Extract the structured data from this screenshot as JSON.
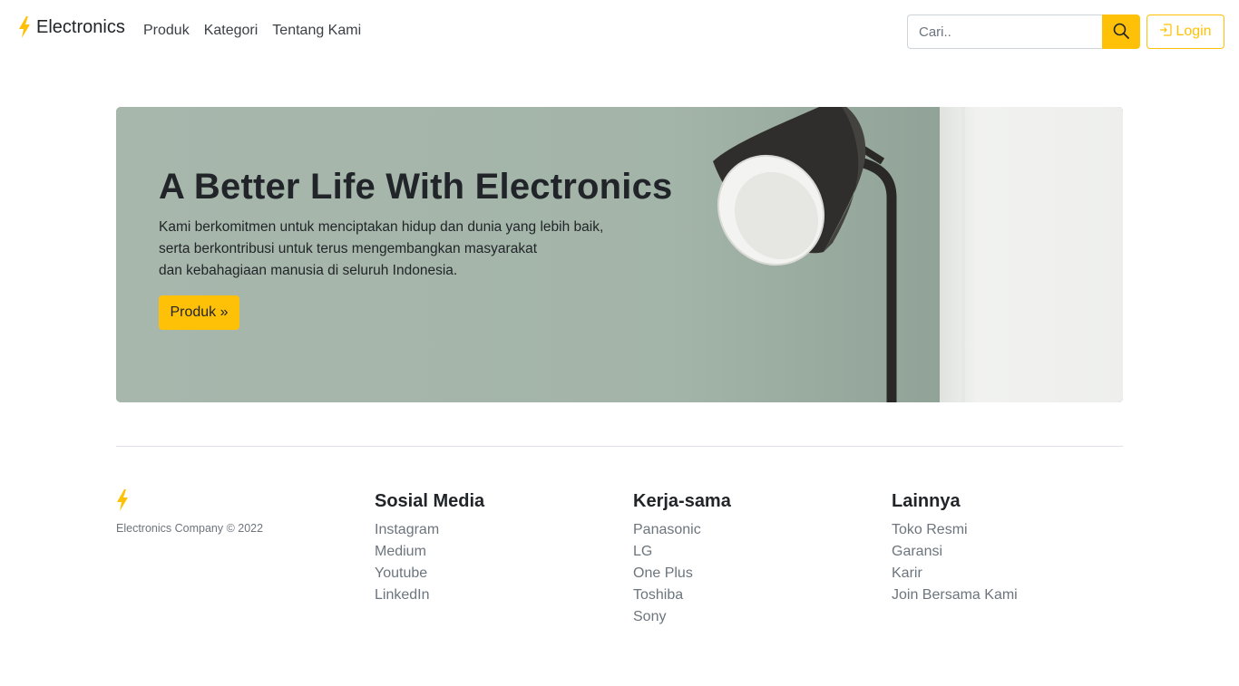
{
  "colors": {
    "accent": "#ffc107",
    "text": "#212529",
    "muted": "#6c757d"
  },
  "navbar": {
    "brand_icon": "lightning-bolt-icon",
    "brand": "Electronics",
    "links": [
      "Produk",
      "Kategori",
      "Tentang Kami"
    ],
    "search_placeholder": "Cari..",
    "search_icon": "search-icon",
    "login_icon": "login-icon",
    "login_label": "Login"
  },
  "hero": {
    "title": "A Better Life With Electronics",
    "description_lines": [
      "Kami berkomitmen untuk menciptakan hidup dan dunia yang lebih baik,",
      "serta berkontribusi untuk terus mengembangkan masyarakat",
      "dan kebahagiaan manusia di seluruh Indonesia."
    ],
    "button_label": "Produk »",
    "image": "floor-lamp-photo"
  },
  "footer": {
    "brand_icon": "lightning-bolt-icon",
    "copyright": "Electronics Company © 2022",
    "columns": [
      {
        "title": "Sosial Media",
        "items": [
          "Instagram",
          "Medium",
          "Youtube",
          "LinkedIn"
        ]
      },
      {
        "title": "Kerja-sama",
        "items": [
          "Panasonic",
          "LG",
          "One Plus",
          "Toshiba",
          "Sony"
        ]
      },
      {
        "title": "Lainnya",
        "items": [
          "Toko Resmi",
          "Garansi",
          "Karir",
          "Join Bersama Kami"
        ]
      }
    ]
  }
}
